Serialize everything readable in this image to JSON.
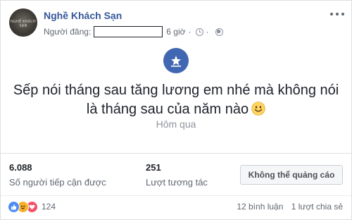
{
  "page": {
    "name": "Nghề Khách Sạn",
    "avatar_text": "NGHỀ KHÁCH SẠN"
  },
  "post": {
    "author_label": "Người đăng:",
    "time": "6 giờ",
    "separator": "·",
    "text_line1": "Sếp nói tháng sau tăng lương em nhé mà không nói",
    "text_line2": "là tháng sau của năm nào",
    "timestamp": "Hôm qua"
  },
  "stats": {
    "reach_value": "6.088",
    "reach_label": "Số người tiếp cận được",
    "engagement_value": "251",
    "engagement_label": "Lượt tương tác",
    "boost_label": "Không thể quảng cáo"
  },
  "footer": {
    "reaction_count": "124",
    "comments": "12 bình luận",
    "shares": "1 lượt chia sẻ"
  },
  "icons": {
    "badge": "star-badge-icon",
    "clock": "clock-icon",
    "globe": "globe-icon",
    "emoji": "smile-emoji-icon"
  },
  "colors": {
    "brand": "#365899",
    "badge": "#4267b2"
  }
}
